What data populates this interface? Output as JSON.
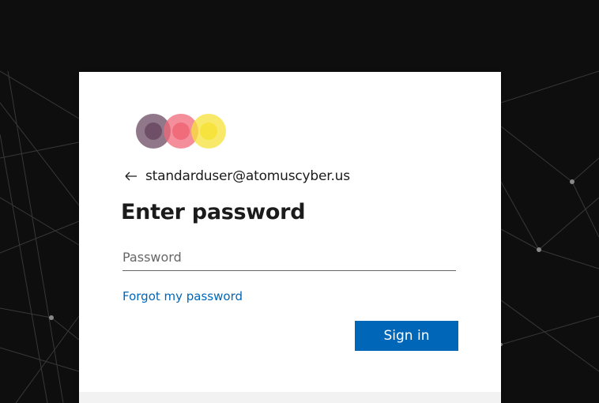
{
  "signin": {
    "identity": "standarduser@atomuscyber.us",
    "title": "Enter password",
    "password_placeholder": "Password",
    "password_value": "",
    "forgot_link": "Forgot my password",
    "submit_label": "Sign in"
  },
  "logo": {
    "circle_colors": [
      "#6b4a63",
      "#f06878",
      "#f5e23a"
    ]
  },
  "icons": {
    "back": "back-arrow-icon"
  },
  "colors": {
    "accent": "#0067b8",
    "background": "#0e0e0e",
    "card": "#ffffff"
  }
}
